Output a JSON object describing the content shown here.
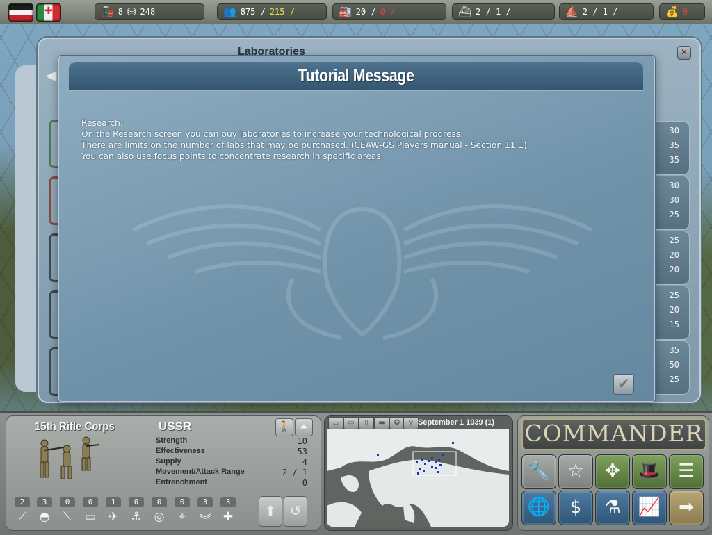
{
  "topbar": {
    "rail": "8",
    "supplies": "248",
    "manpower": "875 /",
    "manpower_income": "215 /",
    "production": "20 /",
    "production_extra": "0 /",
    "ships": "2 /  1 /",
    "subs": "2 /  1 /",
    "gold": "0"
  },
  "research": {
    "title": "Laboratories",
    "group_values": [
      [
        "30",
        "35",
        "35"
      ],
      [
        "30",
        "30",
        "25"
      ],
      [
        "25",
        "20",
        "20"
      ],
      [
        "25",
        "20",
        "15"
      ],
      [
        "35",
        "50",
        "25"
      ]
    ]
  },
  "dialog": {
    "title": "Tutorial Message",
    "lines": [
      "Research:",
      "On the Research screen you can buy laboratories to increase your technological progress.",
      "There are limits on the number of labs that may be purchased. (CEAW-GS Players manual - Section 11.1)",
      "You can also use focus points to concentrate research in specific areas."
    ]
  },
  "unit": {
    "name": "15th Rifle Corps",
    "nation": "USSR",
    "stats": [
      {
        "label": "Strength",
        "value": "10"
      },
      {
        "label": "Effectiveness",
        "value": "53"
      },
      {
        "label": "Supply",
        "value": "4"
      },
      {
        "label": "Movement/Attack Range",
        "value": "2 / 1"
      },
      {
        "label": "Entrenchment",
        "value": "0"
      }
    ],
    "counts": [
      "2",
      "3",
      "0",
      "0",
      "1",
      "0",
      "0",
      "0",
      "3",
      "3"
    ]
  },
  "minimap": {
    "date": "September 1 1939 (1)"
  },
  "commander": {
    "logo": "COMMANDER"
  },
  "colors": {
    "dialog_header": "#3f6480",
    "dialog_body": "#7b9cb3",
    "commander_gold": "#b3a980"
  }
}
